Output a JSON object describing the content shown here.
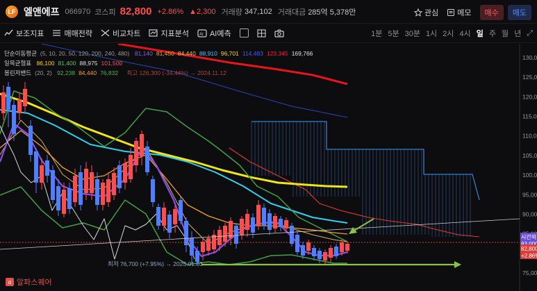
{
  "header": {
    "logo_text": "LF",
    "name": "엘앤에프",
    "code": "066970",
    "market": "코스피",
    "price": "82,800",
    "rate": "+2.86%",
    "change": "▲2,300",
    "volume_label": "거래량",
    "volume": "347,102",
    "amount_label": "거래대금",
    "amount": "285억 5,378만",
    "watch_label": "관심",
    "memo_label": "메모",
    "buy_label": "매수",
    "sell_label": "매도"
  },
  "toolbar": {
    "indicators_label": "보조지표",
    "strategy_label": "매매전략",
    "compare_label": "비교차트",
    "analysis_label": "지표분석",
    "ai_label": "AI예측",
    "timeframes": [
      "1분",
      "5분",
      "30분",
      "1시",
      "2시",
      "4시",
      "일",
      "주",
      "월",
      "년"
    ],
    "active_timeframe": "일"
  },
  "legend": {
    "ma_title": "단순이동평균",
    "ma_params": "(5, 10, 20, 50, 120, 200, 240, 480)",
    "ma_values": [
      "81,140",
      "81,450",
      "84,440",
      "88,910",
      "96,701",
      "114,483",
      "123,345",
      "169,766"
    ],
    "ma_colors": [
      "#8b5cf6",
      "#f5a623",
      "#f5c542",
      "#40c4ff",
      "#ffd600",
      "#3d5afe",
      "#ff1744",
      "#e0e0e0"
    ],
    "ichimoku_title": "일목균형표",
    "ichimoku_values": [
      "86,100",
      "81,400",
      "88,975",
      "101,500"
    ],
    "ichimoku_colors": [
      "#ffd600",
      "#66bb6a",
      "#e0e0e0",
      "#ff5252"
    ],
    "bollinger_title": "볼린저밴드",
    "bollinger_params": "(20, 2)",
    "bollinger_values": [
      "92,238",
      "84,440",
      "76,832"
    ],
    "bollinger_colors": [
      "#4caf50",
      "#f5a623",
      "#4caf50"
    ],
    "overlay_note": "최고 126,300 (-34.44%) → 2024.11.12"
  },
  "chart": {
    "y_labels": [
      "130,000",
      "125,000",
      "120,000",
      "115,000",
      "110,000",
      "105,000",
      "100,000",
      "95,000",
      "90,000",
      "85,000",
      "80,000",
      "75,000"
    ],
    "price_tag_time": "시간외",
    "price_tag_time_value": "83,000",
    "price_tag": "82,800",
    "price_tag_rate": "+2.86%",
    "low_annotation": "최저 76,700 (+7.95%) → 2025.01.03"
  },
  "watermark": {
    "text": "알파스퀘어"
  },
  "colors": {
    "up": "#ff4d4f",
    "down": "#4d7fff",
    "background": "#0d0d0f",
    "arrow": "#8bc34a"
  },
  "icons": [
    "star-icon",
    "memo-icon",
    "indicator-icon",
    "strategy-icon",
    "compare-icon",
    "analysis-icon",
    "ai-icon",
    "camera-icon",
    "expand-icon"
  ]
}
